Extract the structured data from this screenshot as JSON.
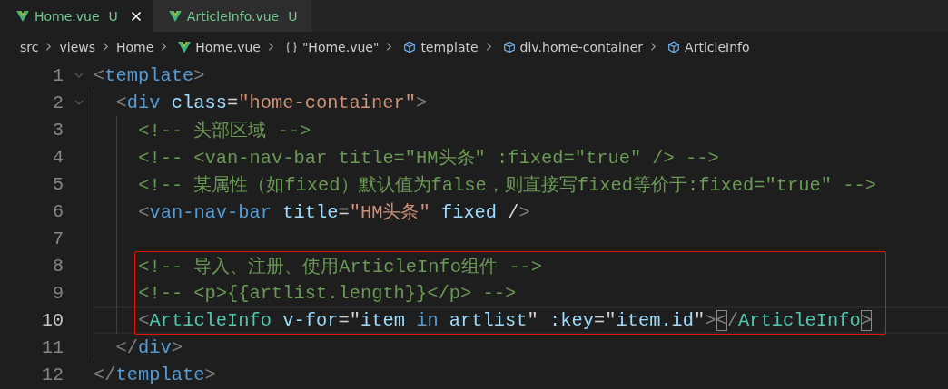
{
  "tabs": [
    {
      "label": "Home.vue",
      "status": "U",
      "selected": true
    },
    {
      "label": "ArticleInfo.vue",
      "status": "U",
      "selected": false
    }
  ],
  "breadcrumbs": [
    {
      "text": "src",
      "kind": "folder"
    },
    {
      "text": "views",
      "kind": "folder"
    },
    {
      "text": "Home",
      "kind": "folder"
    },
    {
      "text": "Home.vue",
      "kind": "vue"
    },
    {
      "text": "\"Home.vue\"",
      "kind": "object"
    },
    {
      "text": "template",
      "kind": "element"
    },
    {
      "text": "div.home-container",
      "kind": "element"
    },
    {
      "text": "ArticleInfo",
      "kind": "element"
    }
  ],
  "code": {
    "lines": [
      {
        "kind": "line",
        "number": "1",
        "current": false,
        "expanded": true,
        "tokens": [
          {
            "t": "<",
            "kind": "punct"
          },
          {
            "t": "template",
            "kind": "tag"
          },
          {
            "t": ">",
            "kind": "punct"
          }
        ],
        "children": [
          {
            "kind": "line",
            "number": "2",
            "current": false,
            "expanded": true,
            "tokens": [
              {
                "t": "<",
                "kind": "punct"
              },
              {
                "t": "div",
                "kind": "tag"
              },
              {
                "t": " class",
                "kind": "attr"
              },
              {
                "t": "=",
                "kind": "text"
              },
              {
                "t": "\"home-container\"",
                "kind": "string"
              },
              {
                "t": ">",
                "kind": "punct"
              }
            ],
            "children": [
              {
                "kind": "line",
                "number": "3",
                "current": false,
                "tokens": [
                  {
                    "t": "<!-- 头部区域 -->",
                    "kind": "comment"
                  }
                ]
              },
              {
                "kind": "line",
                "number": "4",
                "current": false,
                "tokens": [
                  {
                    "t": "<!-- <van-nav-bar title=\"HM头条\" :fixed=\"true\" /> -->",
                    "kind": "comment"
                  }
                ]
              },
              {
                "kind": "line",
                "number": "5",
                "current": false,
                "tokens": [
                  {
                    "t": "<!-- 某属性（如fixed）默认值为false，则直接写fixed等价于:fixed=\"true\" -->",
                    "kind": "comment"
                  }
                ]
              },
              {
                "kind": "line",
                "number": "6",
                "current": false,
                "tokens": [
                  {
                    "t": "<",
                    "kind": "punct"
                  },
                  {
                    "t": "van-nav-bar",
                    "kind": "tag"
                  },
                  {
                    "t": " title",
                    "kind": "attr"
                  },
                  {
                    "t": "=",
                    "kind": "text"
                  },
                  {
                    "t": "\"HM头条\"",
                    "kind": "string"
                  },
                  {
                    "t": " fixed",
                    "kind": "attr"
                  },
                  {
                    "t": " /",
                    "kind": "text"
                  },
                  {
                    "t": ">",
                    "kind": "punct"
                  }
                ]
              },
              {
                "kind": "line",
                "number": "7",
                "current": false
              },
              {
                "kind": "highlight",
                "children": [
                  {
                    "kind": "line",
                    "number": "8",
                    "current": false,
                    "tokens": [
                      {
                        "t": "<!-- 导入、注册、使用ArticleInfo组件 -->",
                        "kind": "comment"
                      }
                    ]
                  },
                  {
                    "kind": "line",
                    "number": "9",
                    "current": false,
                    "tokens": [
                      {
                        "t": "<!-- <p>{{artlist.length}}</p> -->",
                        "kind": "comment"
                      }
                    ]
                  },
                  {
                    "kind": "line",
                    "number": "10",
                    "current": true,
                    "tokens": [
                      {
                        "t": "<",
                        "kind": "punct",
                        "matched": false
                      },
                      {
                        "t": "ArticleInfo",
                        "kind": "component"
                      },
                      {
                        "t": " v-for",
                        "kind": "attr"
                      },
                      {
                        "t": "=\"",
                        "kind": "text"
                      },
                      {
                        "t": "item",
                        "kind": "var"
                      },
                      {
                        "t": " in ",
                        "kind": "keyword"
                      },
                      {
                        "t": "artlist",
                        "kind": "var"
                      },
                      {
                        "t": "\"",
                        "kind": "text"
                      },
                      {
                        "t": " :key",
                        "kind": "attr"
                      },
                      {
                        "t": "=\"",
                        "kind": "text"
                      },
                      {
                        "t": "item.id",
                        "kind": "var"
                      },
                      {
                        "t": "\"",
                        "kind": "text"
                      },
                      {
                        "t": ">",
                        "kind": "punct",
                        "matched": false
                      },
                      {
                        "t": "<",
                        "kind": "punct",
                        "matched": true
                      },
                      {
                        "t": "/",
                        "kind": "punct"
                      },
                      {
                        "t": "ArticleInfo",
                        "kind": "component"
                      },
                      {
                        "t": ">",
                        "kind": "punct",
                        "matched": true
                      }
                    ]
                  }
                ]
              }
            ]
          },
          {
            "kind": "line",
            "number": "11",
            "current": false,
            "tokens": [
              {
                "t": "</",
                "kind": "punct"
              },
              {
                "t": "div",
                "kind": "tag"
              },
              {
                "t": ">",
                "kind": "punct"
              }
            ]
          }
        ]
      },
      {
        "kind": "line",
        "number": "12",
        "current": false,
        "tokens": [
          {
            "t": "</",
            "kind": "punct"
          },
          {
            "t": "template",
            "kind": "tag"
          },
          {
            "t": ">",
            "kind": "punct"
          }
        ]
      }
    ]
  }
}
